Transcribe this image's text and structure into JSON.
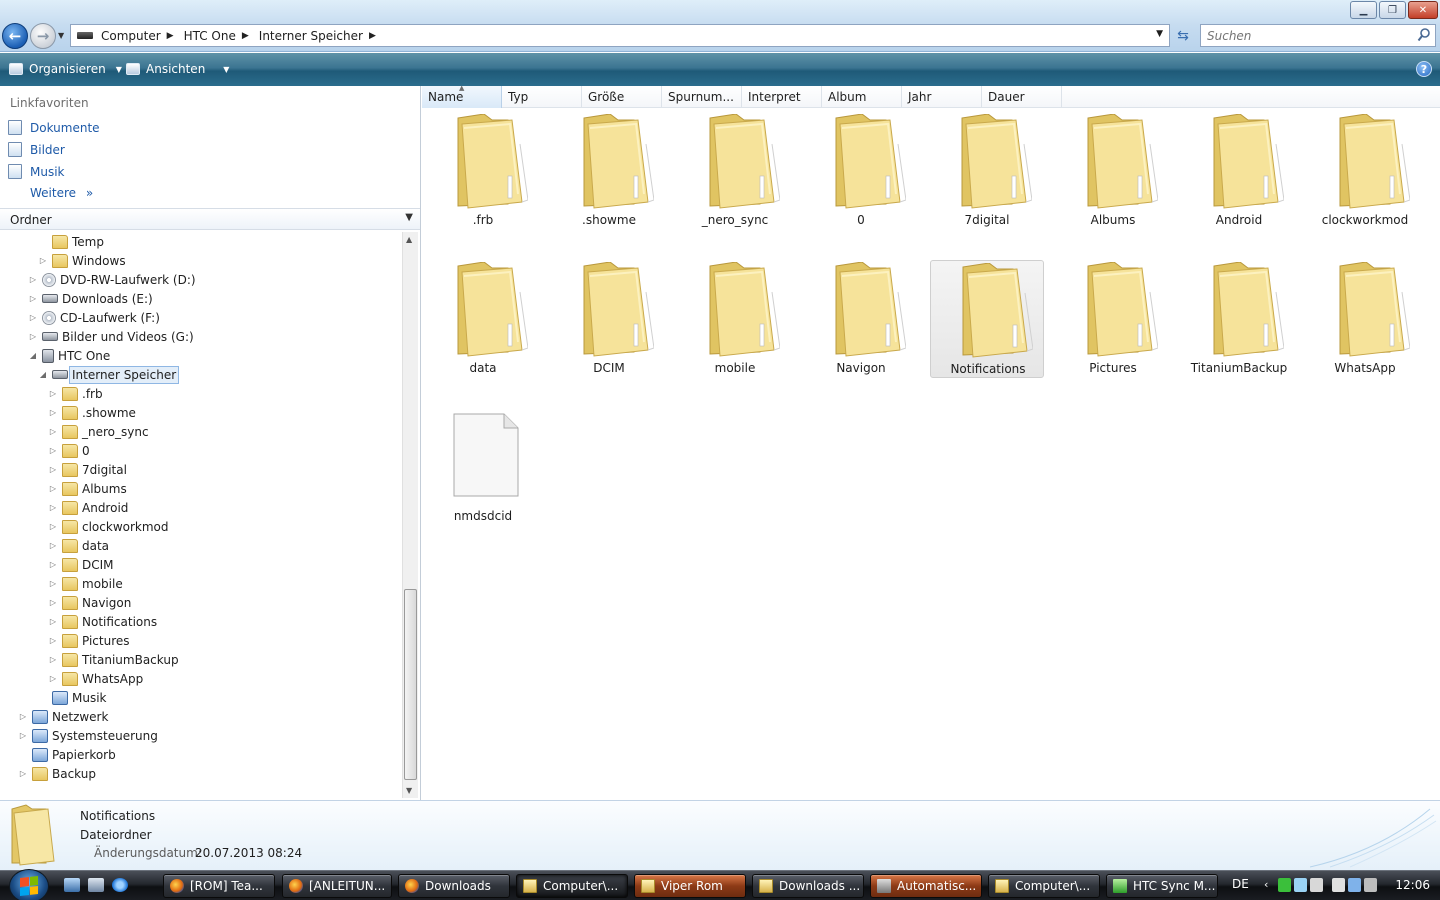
{
  "window": {
    "breadcrumbs": [
      "Computer",
      "HTC One",
      "Interner Speicher"
    ],
    "search_placeholder": "Suchen"
  },
  "toolbar": {
    "organize_label": "Organisieren",
    "views_label": "Ansichten"
  },
  "favorites": {
    "header": "Linkfavoriten",
    "items": [
      "Dokumente",
      "Bilder",
      "Musik"
    ],
    "more_label": "Weitere"
  },
  "folders": {
    "header": "Ordner",
    "tree": [
      {
        "label": "Temp",
        "icon": "folder",
        "expander": ""
      },
      {
        "label": "Windows",
        "icon": "folder",
        "expander": "collapsed"
      },
      {
        "label": "DVD-RW-Laufwerk (D:)",
        "icon": "disc",
        "expander": "collapsed"
      },
      {
        "label": "Downloads (E:)",
        "icon": "drive",
        "expander": "collapsed"
      },
      {
        "label": "CD-Laufwerk (F:)",
        "icon": "disc",
        "expander": "collapsed"
      },
      {
        "label": "Bilder und Videos (G:)",
        "icon": "drive",
        "expander": "collapsed"
      },
      {
        "label": "HTC One",
        "icon": "device",
        "expander": "expanded"
      },
      {
        "label": "Interner Speicher",
        "icon": "drive",
        "expander": "expanded",
        "selected": true
      },
      {
        "label": ".frb",
        "icon": "folder",
        "expander": "collapsed"
      },
      {
        "label": ".showme",
        "icon": "folder",
        "expander": "collapsed"
      },
      {
        "label": "_nero_sync",
        "icon": "folder",
        "expander": "collapsed"
      },
      {
        "label": "0",
        "icon": "folder",
        "expander": "collapsed"
      },
      {
        "label": "7digital",
        "icon": "folder",
        "expander": "collapsed"
      },
      {
        "label": "Albums",
        "icon": "folder",
        "expander": "collapsed"
      },
      {
        "label": "Android",
        "icon": "folder",
        "expander": "collapsed"
      },
      {
        "label": "clockworkmod",
        "icon": "folder",
        "expander": "collapsed"
      },
      {
        "label": "data",
        "icon": "folder",
        "expander": "collapsed"
      },
      {
        "label": "DCIM",
        "icon": "folder",
        "expander": "collapsed"
      },
      {
        "label": "mobile",
        "icon": "folder",
        "expander": "collapsed"
      },
      {
        "label": "Navigon",
        "icon": "folder",
        "expander": "collapsed"
      },
      {
        "label": "Notifications",
        "icon": "folder",
        "expander": "collapsed"
      },
      {
        "label": "Pictures",
        "icon": "folder",
        "expander": "collapsed"
      },
      {
        "label": "TitaniumBackup",
        "icon": "folder",
        "expander": "collapsed"
      },
      {
        "label": "WhatsApp",
        "icon": "folder",
        "expander": "collapsed"
      },
      {
        "label": "Musik",
        "icon": "special",
        "expander": ""
      },
      {
        "label": "Netzwerk",
        "icon": "special",
        "expander": "collapsed"
      },
      {
        "label": "Systemsteuerung",
        "icon": "special",
        "expander": "collapsed"
      },
      {
        "label": "Papierkorb",
        "icon": "special",
        "expander": ""
      },
      {
        "label": "Backup",
        "icon": "folder",
        "expander": "collapsed"
      }
    ]
  },
  "columns": [
    "Name",
    "Typ",
    "Größe",
    "Spurnum...",
    "Interpret",
    "Album",
    "Jahr",
    "Dauer"
  ],
  "items": [
    {
      "name": ".frb",
      "kind": "folder"
    },
    {
      "name": ".showme",
      "kind": "folder"
    },
    {
      "name": "_nero_sync",
      "kind": "folder"
    },
    {
      "name": "0",
      "kind": "folder"
    },
    {
      "name": "7digital",
      "kind": "folder"
    },
    {
      "name": "Albums",
      "kind": "folder"
    },
    {
      "name": "Android",
      "kind": "folder"
    },
    {
      "name": "clockworkmod",
      "kind": "folder"
    },
    {
      "name": "data",
      "kind": "folder"
    },
    {
      "name": "DCIM",
      "kind": "folder"
    },
    {
      "name": "mobile",
      "kind": "folder"
    },
    {
      "name": "Navigon",
      "kind": "folder"
    },
    {
      "name": "Notifications",
      "kind": "folder",
      "selected": true
    },
    {
      "name": "Pictures",
      "kind": "folder"
    },
    {
      "name": "TitaniumBackup",
      "kind": "folder"
    },
    {
      "name": "WhatsApp",
      "kind": "folder"
    },
    {
      "name": "nmdsdcid",
      "kind": "file"
    }
  ],
  "details": {
    "name": "Notifications",
    "type": "Dateiordner",
    "date_label": "Änderungsdatum:",
    "date_value": "20.07.2013 08:24"
  },
  "taskbar": {
    "tasks": [
      {
        "label": "[ROM] Tea...",
        "icon": "ff",
        "state": "normal"
      },
      {
        "label": "[ANLEITUN...",
        "icon": "ff",
        "state": "normal"
      },
      {
        "label": "Downloads",
        "icon": "ff",
        "state": "normal"
      },
      {
        "label": "Computer\\...",
        "icon": "fold",
        "state": "active"
      },
      {
        "label": "Viper Rom",
        "icon": "fold",
        "state": "orange"
      },
      {
        "label": "Downloads ...",
        "icon": "fold",
        "state": "normal"
      },
      {
        "label": "Automatisc...",
        "icon": "tool",
        "state": "orange"
      },
      {
        "label": "Computer\\...",
        "icon": "fold",
        "state": "normal"
      },
      {
        "label": "HTC Sync M...",
        "icon": "green",
        "state": "normal"
      }
    ],
    "language": "DE",
    "clock": "12:06"
  }
}
